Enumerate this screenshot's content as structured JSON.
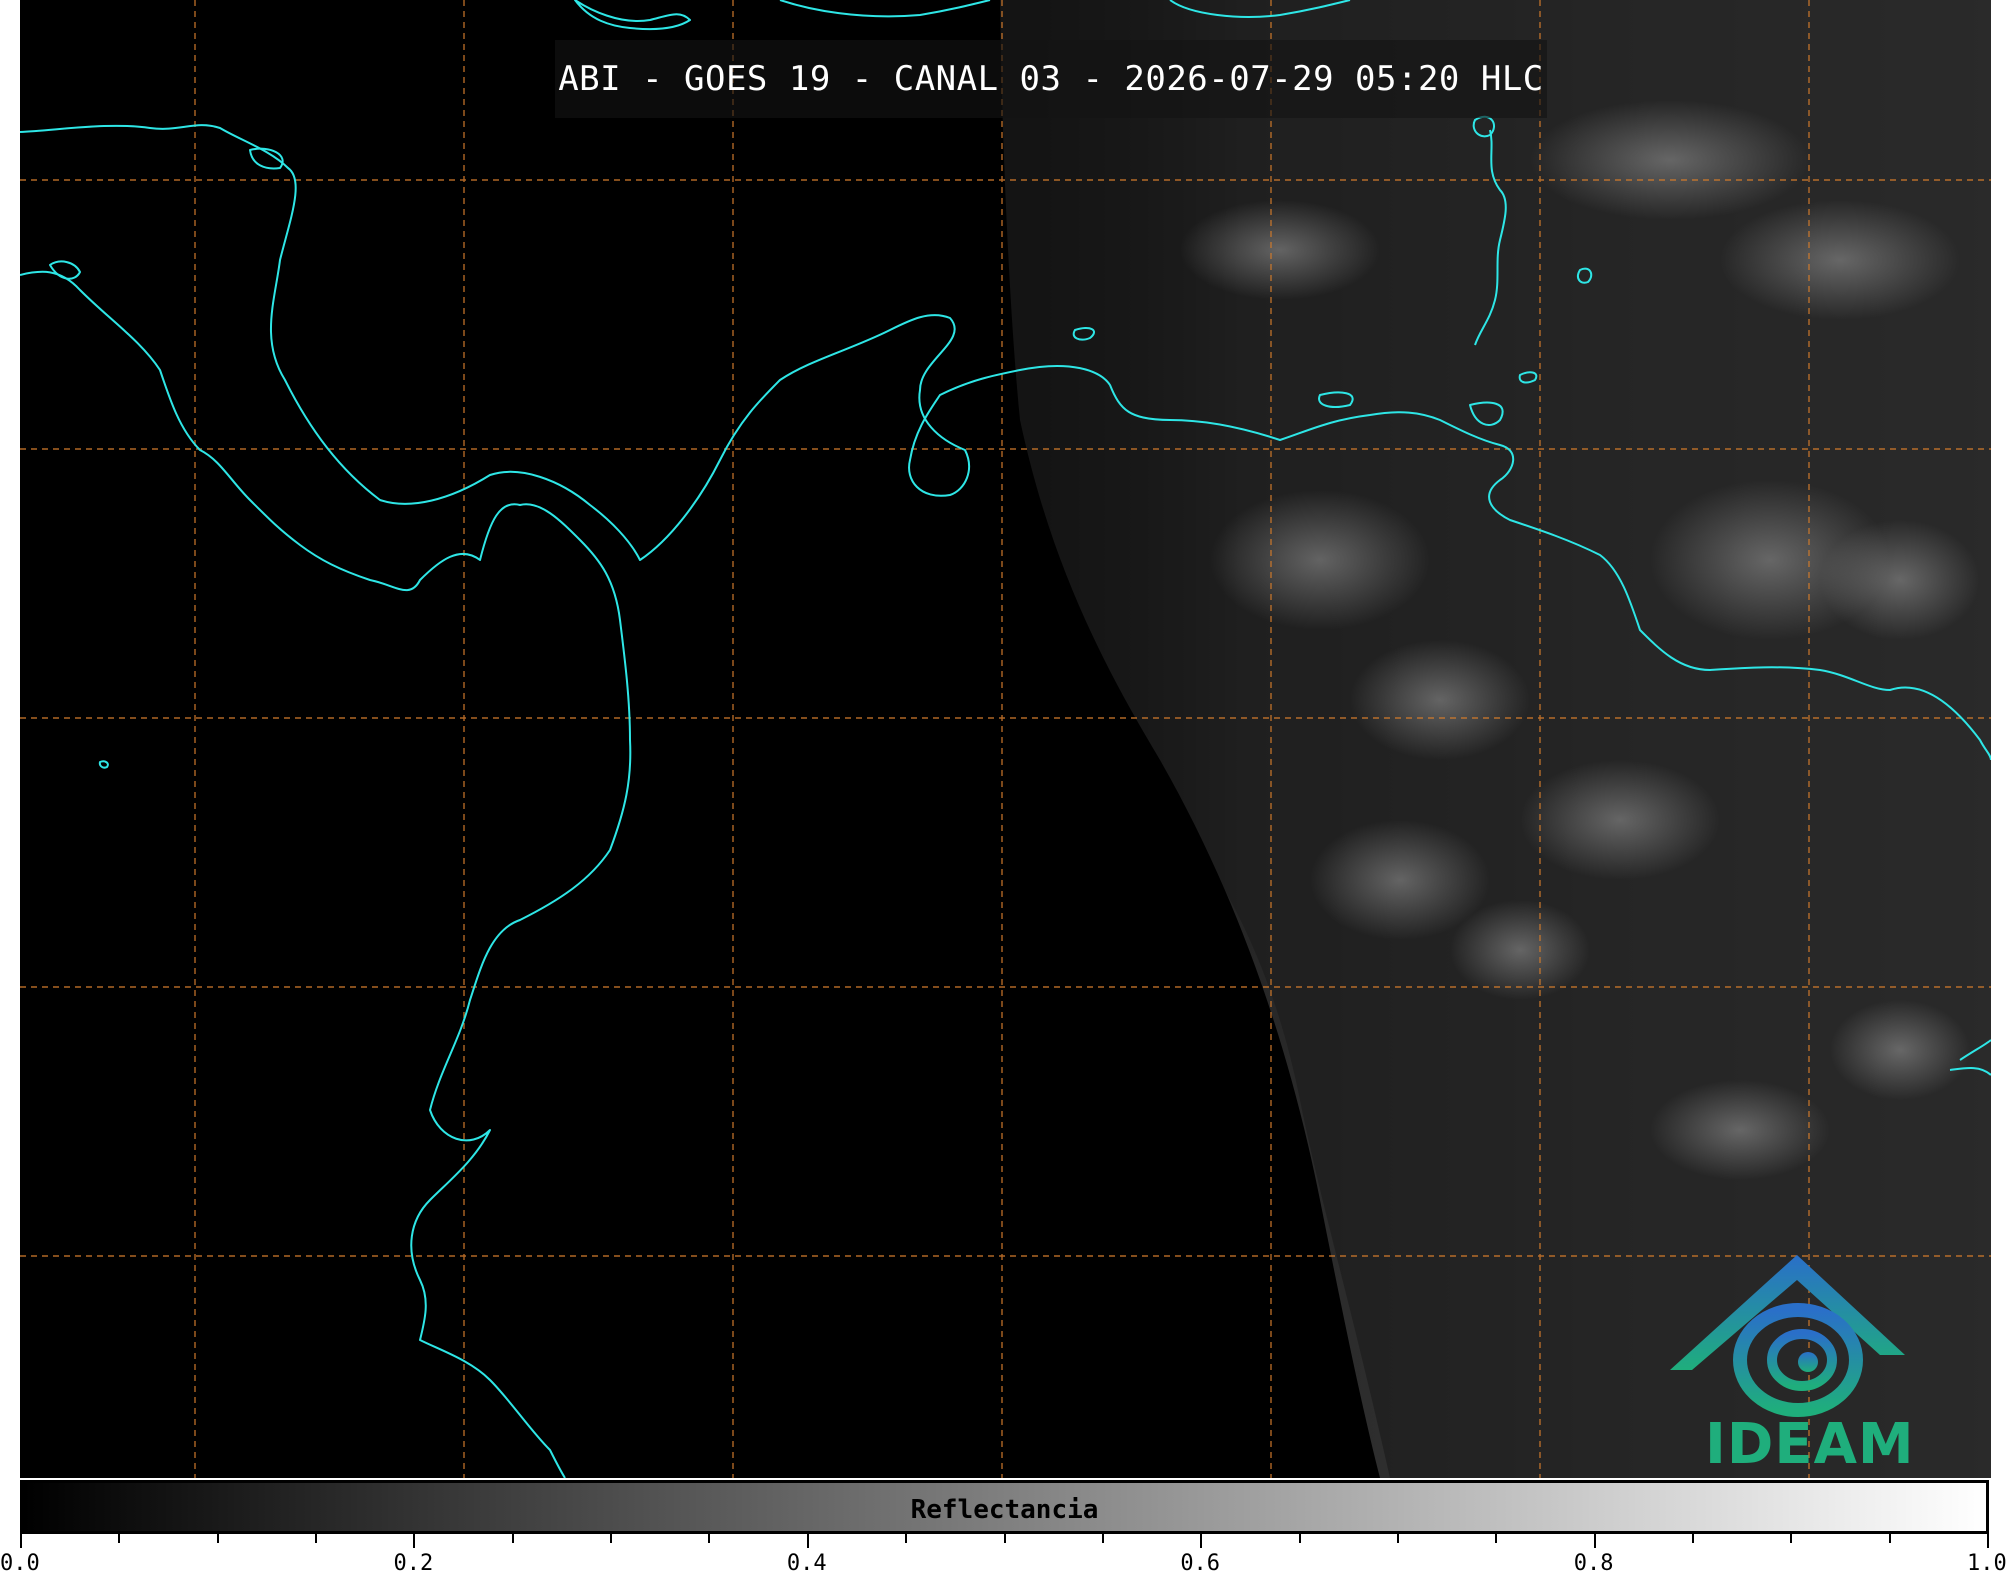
{
  "title": "ABI - GOES 19 - CANAL 03 - 2026-07-29 05:20 HLC",
  "colors": {
    "coastline": "#2ee6e6",
    "gridline": "#d07a2c",
    "logo_gradient_top": "#2a6fc9",
    "logo_gradient_bottom": "#1fae7c"
  },
  "logo": {
    "text": "IDEAM",
    "icon": "ideam-mountain-swirl-icon"
  },
  "colorbar": {
    "label": "Reflectancia",
    "min": 0.0,
    "max": 1.0,
    "major_ticks": [
      "0.0",
      "0.2",
      "0.4",
      "0.6",
      "0.8",
      "1.0"
    ],
    "minor_step": 0.05
  }
}
